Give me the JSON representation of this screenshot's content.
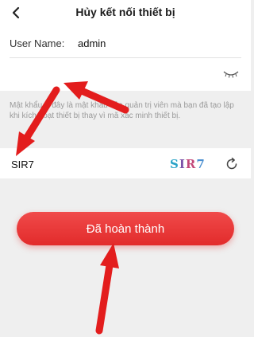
{
  "header": {
    "title": "Hủy kết nối thiết bị",
    "back_icon": "chevron-left-icon"
  },
  "form": {
    "user_label": "User Name:",
    "user_value": "admin",
    "password_value": "",
    "eye_icon": "eye-closed-icon"
  },
  "hint": "Mật khẩu ở đây là mật khẩu của quản trị viên mà bạn đã tạo lập khi kích hoạt thiết bị thay vì mã xác minh thiết bị.",
  "captcha": {
    "input_value": "SIR7",
    "image_text": [
      "S",
      "I",
      "R",
      "7"
    ],
    "refresh_icon": "refresh-icon"
  },
  "done_button": "Đã hoàn thành",
  "colors": {
    "accent": "#e22b2b",
    "annotation_arrow": "#e31d1d",
    "background": "#efefef"
  }
}
